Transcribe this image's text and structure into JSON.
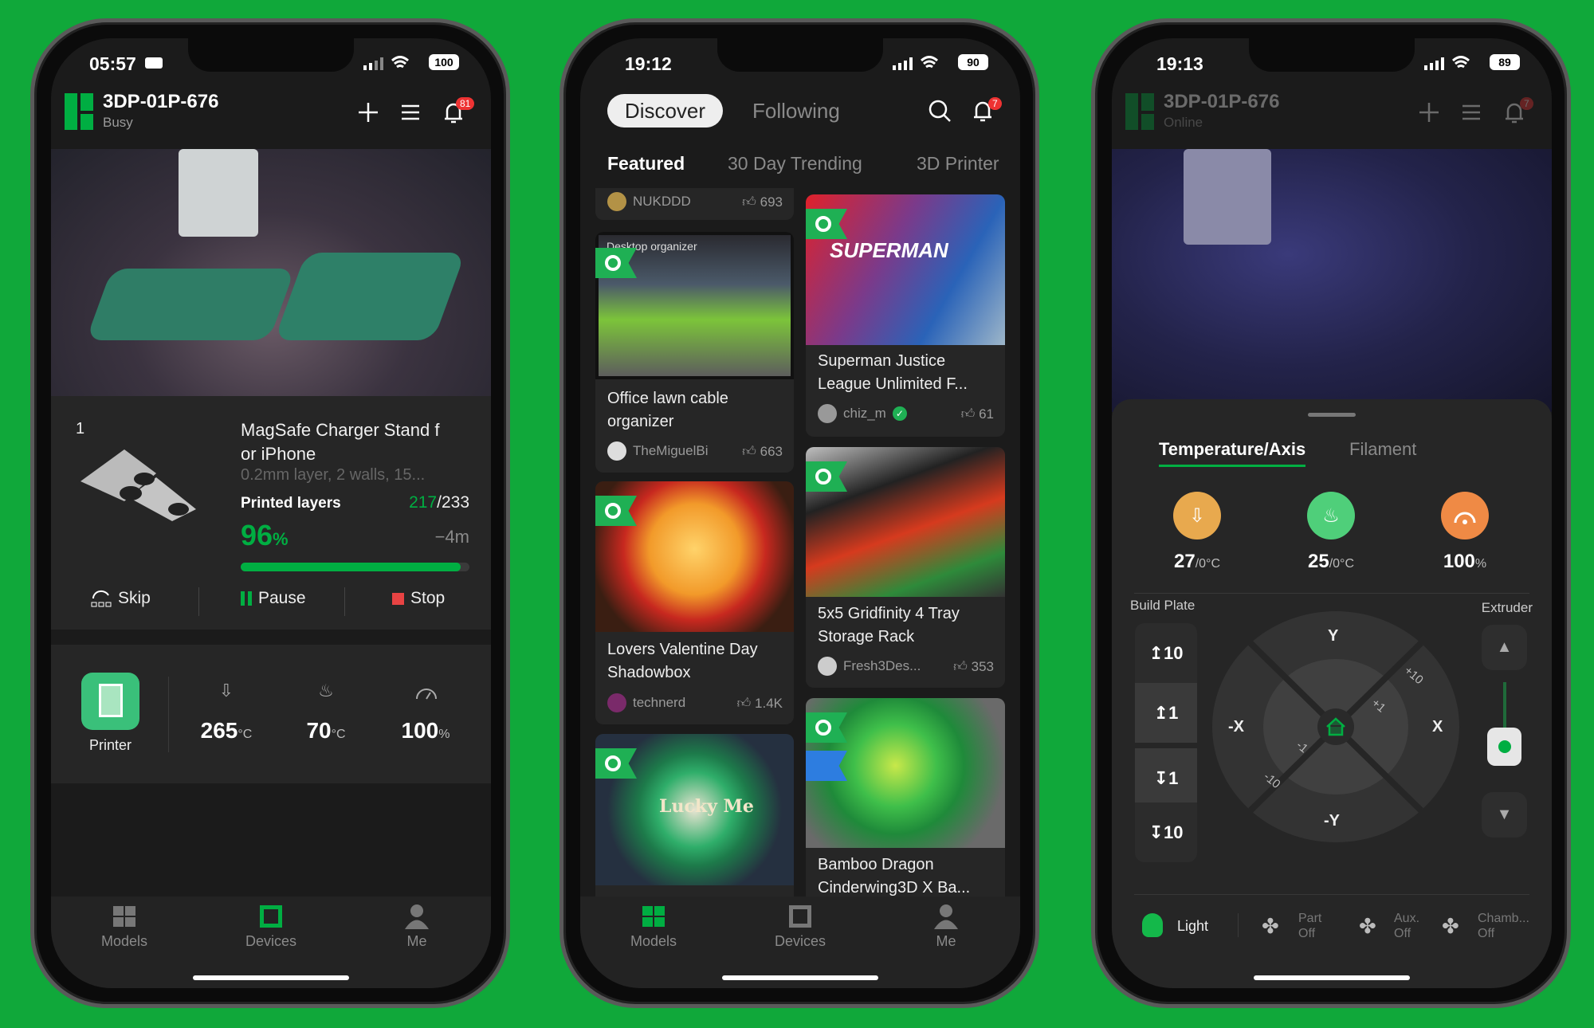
{
  "colors": {
    "background": "#10a83a",
    "accent": "#00ae42",
    "danger": "#e84343",
    "nozzle": "#e8a94e",
    "bed": "#4fcf7a",
    "speed": "#ef8a45"
  },
  "phone1": {
    "status": {
      "time": "05:57",
      "battery": "100",
      "sleep_icon": "bed-icon"
    },
    "header": {
      "title": "3DP-01P-676",
      "subtitle": "Busy",
      "notification_count": "81"
    },
    "job": {
      "plate_number": "1",
      "title_line1": "MagSafe Charger Stand f",
      "title_line2": "or iPhone",
      "settings": "0.2mm layer, 2 walls, 15...",
      "layers_label": "Printed layers",
      "layers_done": "217",
      "layers_total": "/233",
      "progress_value": "96",
      "progress_unit": "%",
      "progress_fraction": 0.96,
      "remaining": "−4m"
    },
    "actions": {
      "skip": "Skip",
      "pause": "Pause",
      "stop": "Stop"
    },
    "stats": {
      "printer_label": "Printer",
      "nozzle": "265",
      "nozzle_unit": "°C",
      "bed": "70",
      "bed_unit": "°C",
      "speed": "100",
      "speed_unit": "%"
    },
    "tabs": [
      {
        "label": "Models"
      },
      {
        "label": "Devices",
        "active": true
      },
      {
        "label": "Me"
      }
    ]
  },
  "phone2": {
    "status": {
      "time": "19:12",
      "battery": "90"
    },
    "header": {
      "discover": "Discover",
      "following": "Following",
      "notification_count": "7"
    },
    "categories": [
      "Featured",
      "30 Day Trending",
      "3D Printer"
    ],
    "feed": {
      "partial": {
        "author": "NUKDDD",
        "likes": "693"
      },
      "col1": [
        {
          "title": "Office lawn cable organizer",
          "author": "TheMiguelBi",
          "likes": "663",
          "image_text": "Desktop organizer"
        },
        {
          "title": "Lovers Valentine Day Shadowbox",
          "author": "technerd",
          "likes": "1.4K"
        },
        {
          "title": "",
          "image_text": "Lucky Me"
        }
      ],
      "col2": [
        {
          "title": "Superman Justice League Unlimited F...",
          "author": "chiz_m",
          "verified": true,
          "likes": "61",
          "image_text": "SUPERMAN"
        },
        {
          "title": "5x5 Gridfinity 4 Tray Storage Rack",
          "author": "Fresh3Des...",
          "likes": "353"
        },
        {
          "title": "Bamboo Dragon Cinderwing3D X Ba..."
        }
      ]
    },
    "tabs": [
      {
        "label": "Models",
        "active": true
      },
      {
        "label": "Devices"
      },
      {
        "label": "Me"
      }
    ]
  },
  "phone3": {
    "status": {
      "time": "19:13",
      "battery": "89"
    },
    "header": {
      "title": "3DP-01P-676",
      "subtitle": "Online",
      "notification_count": "7"
    },
    "sheet": {
      "tabs": [
        "Temperature/Axis",
        "Filament"
      ],
      "nozzle": "27",
      "nozzle_target": "/0°C",
      "bed": "25",
      "bed_target": "/0°C",
      "speed": "100",
      "speed_unit": "%",
      "build_plate_label": "Build Plate",
      "extruder_label": "Extruder",
      "z_buttons": [
        "↥10",
        "↥1",
        "↧1",
        "↧10"
      ],
      "joystick": {
        "y": "Y",
        "neg_y": "-Y",
        "x": "X",
        "neg_x": "-X",
        "plus10": "+10",
        "plus1": "+1",
        "minus1": "-1",
        "minus10": "-10"
      },
      "light": "Light",
      "fans": [
        {
          "name": "Part",
          "state": "Off"
        },
        {
          "name": "Aux.",
          "state": "Off"
        },
        {
          "name": "Chamb...",
          "state": "Off"
        }
      ]
    }
  }
}
